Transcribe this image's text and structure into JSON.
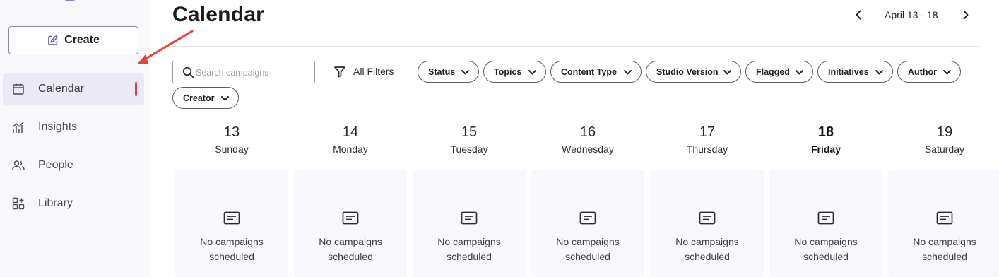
{
  "sidebar": {
    "create_label": "Create",
    "items": [
      {
        "label": "Calendar",
        "icon": "calendar-icon",
        "active": true
      },
      {
        "label": "Insights",
        "icon": "insights-icon",
        "active": false
      },
      {
        "label": "People",
        "icon": "people-icon",
        "active": false
      },
      {
        "label": "Library",
        "icon": "library-icon",
        "active": false
      }
    ]
  },
  "header": {
    "title": "Calendar",
    "date_range": "April 13 - 18"
  },
  "filters": {
    "search_placeholder": "Search campaigns",
    "all_filters_label": "All Filters",
    "chips": [
      "Status",
      "Topics",
      "Content Type",
      "Studio Version",
      "Flagged",
      "Initiatives",
      "Author",
      "Creator"
    ]
  },
  "calendar": {
    "empty_line1": "No campaigns",
    "empty_line2": "scheduled",
    "days": [
      {
        "num": "13",
        "name": "Sunday"
      },
      {
        "num": "14",
        "name": "Monday"
      },
      {
        "num": "15",
        "name": "Tuesday"
      },
      {
        "num": "16",
        "name": "Wednesday"
      },
      {
        "num": "17",
        "name": "Thursday"
      },
      {
        "num": "18",
        "name": "Friday",
        "today": true
      },
      {
        "num": "19",
        "name": "Saturday"
      }
    ]
  },
  "colors": {
    "accent": "#6e5bd8",
    "active_indicator": "#e5364f",
    "annotation_arrow": "#e0443a",
    "sidebar_bg": "#f8f7fc"
  }
}
